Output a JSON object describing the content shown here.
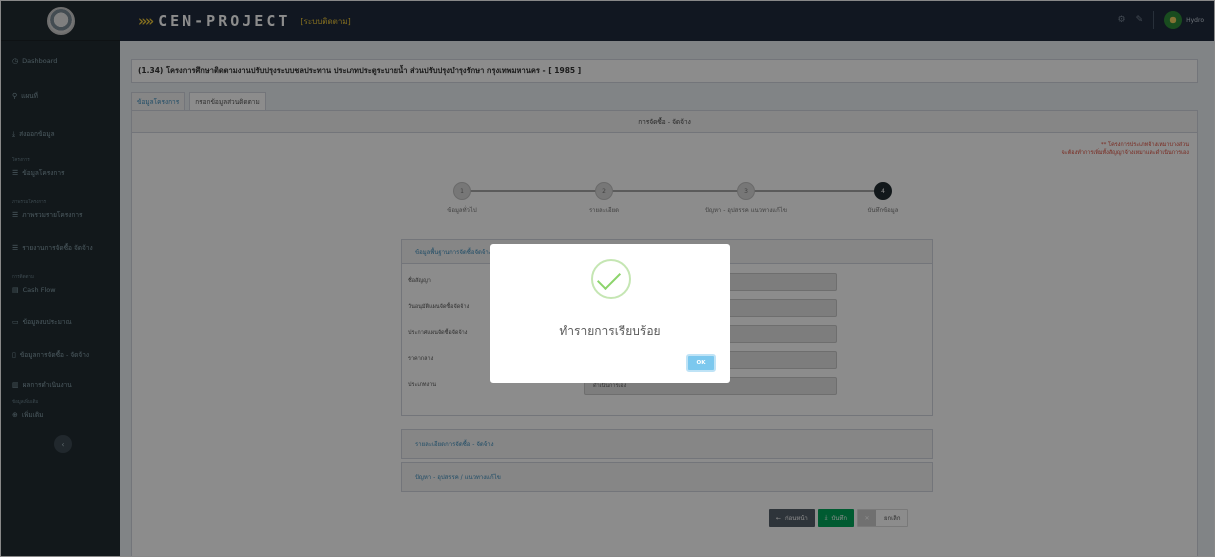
{
  "header": {
    "brand": "CEN-PROJECT",
    "brand_chevrons": "»»",
    "subtitle": "[ระบบติดตาม]",
    "user_name": "Hydro"
  },
  "sidebar": {
    "items": [
      {
        "label": "Dashboard",
        "icon": "dashboard-icon"
      },
      {
        "label": "แผนที่",
        "icon": "map-marker-icon"
      },
      {
        "label": "ส่งออกข้อมูล",
        "icon": "download-icon"
      },
      {
        "label": "ข้อมูลโครงการ",
        "icon": "list-icon"
      },
      {
        "label": "ภาพรวมรายโครงการ",
        "icon": "list-icon"
      },
      {
        "label": "รายงานการจัดซื้อ จัดจ้าง",
        "icon": "list-icon"
      },
      {
        "label": "Cash Flow",
        "icon": "chart-icon"
      },
      {
        "label": "ข้อมูลงบประมาณ",
        "icon": "money-icon"
      },
      {
        "label": "ข้อมูลการจัดซื้อ - จัดจ้าง",
        "icon": "document-icon"
      },
      {
        "label": "ผลการดำเนินงาน",
        "icon": "bar-chart-icon"
      },
      {
        "label": "เพิ่มเติม",
        "icon": "plus-circle-icon"
      }
    ],
    "sections": [
      "โครงการ",
      "ภาพรวมโครงการ",
      "การติดตาม",
      "ข้อมูลเพิ่มเติม"
    ]
  },
  "project": {
    "title": "(1.34) โครงการศึกษาติดตามงานปรับปรุงระบบชลประทาน ประเภทประตูระบายน้ำ ส่วนปรับปรุงบำรุงรักษา กรุงเทพมหานคร - [ 1985 ]",
    "tabs": [
      {
        "label": "ข้อมูลโครงการ"
      },
      {
        "label": "กรอกข้อมูลส่วนติดตาม"
      }
    ]
  },
  "panel": {
    "heading": "การจัดซื้อ - จัดจ้าง",
    "note_line1": "** โครงการประเภทจ้างเหมาบางส่วน",
    "note_line2": "จะต้องทำการเพิ่มทั้งสัญญาจ้างเหมาและดำเนินการเอง"
  },
  "stepper": {
    "steps": [
      {
        "num": "1",
        "label": "ข้อมูลทั่วไป"
      },
      {
        "num": "2",
        "label": "รายละเอียด"
      },
      {
        "num": "3",
        "label": "ปัญหา - อุปสรรค แนวทางแก้ไข"
      },
      {
        "num": "4",
        "label": "บันทึกข้อมูล"
      }
    ],
    "current_step": 4
  },
  "form": {
    "heading": "ข้อมูลพื้นฐานการจัดซื้อจัดจ้าง",
    "fields": [
      {
        "label": "ชื่อสัญญา",
        "value": ""
      },
      {
        "label": "วันอนุมัติแผนจัดซื้อจัดจ้าง",
        "value": ""
      },
      {
        "label": "ประกาศแผนจัดซื้อจัดจ้าง",
        "value": ""
      },
      {
        "label": "ราคากลาง",
        "value": ""
      },
      {
        "label": "ประเภทงาน",
        "value": "ดำเนินการเอง"
      }
    ],
    "sections": [
      {
        "label": "รายละเอียดการจัดซื้อ - จัดจ้าง"
      },
      {
        "label": "ปัญหา - อุปสรรค / แนวทางแก้ไข"
      }
    ]
  },
  "buttons": {
    "back": "ก่อนหน้า",
    "save": "บันทึก",
    "cancel": "ยกเลิก"
  },
  "modal": {
    "message": "ทำรายการเรียบร้อย",
    "ok": "OK"
  }
}
